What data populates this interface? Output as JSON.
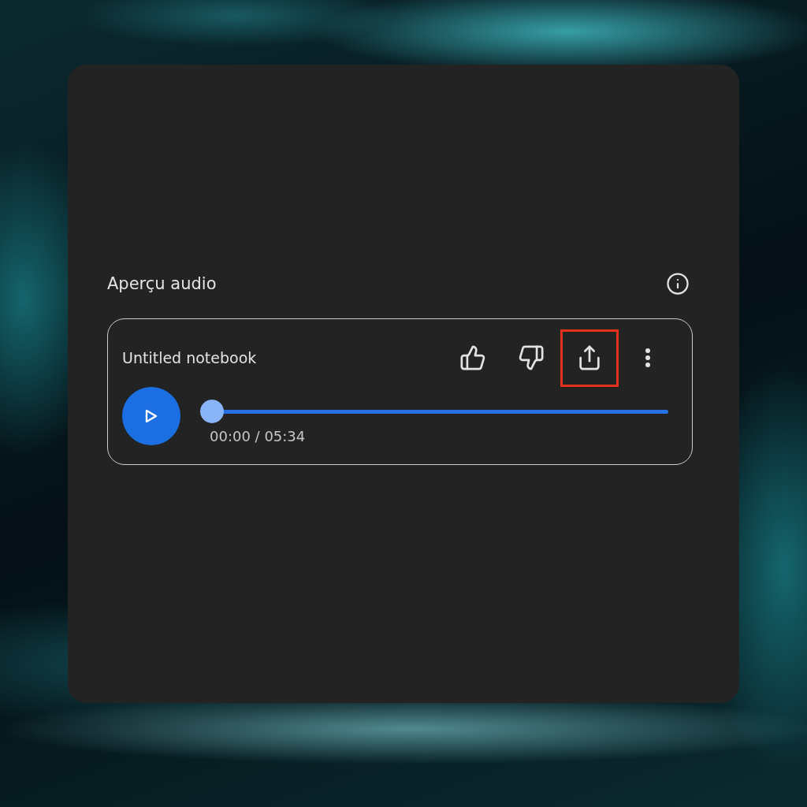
{
  "section": {
    "title": "Aperçu audio"
  },
  "player": {
    "title": "Untitled notebook",
    "actions": [
      {
        "kind": "like",
        "highlighted": false
      },
      {
        "kind": "dislike",
        "highlighted": false
      },
      {
        "kind": "share",
        "highlighted": true
      },
      {
        "kind": "more",
        "highlighted": false
      }
    ],
    "playing": false,
    "progress": {
      "level": 0,
      "reading": "00:00 / 05:34"
    }
  }
}
